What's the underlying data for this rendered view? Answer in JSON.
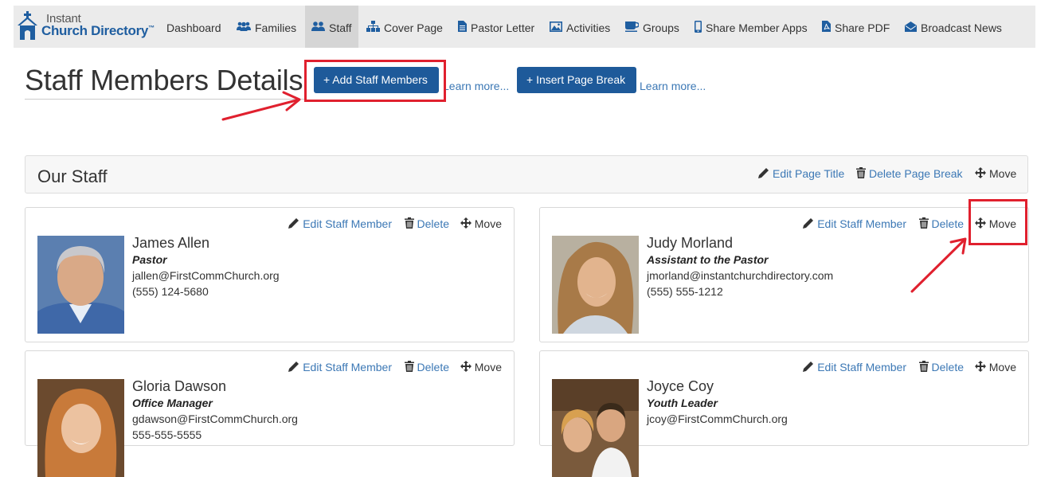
{
  "brand": {
    "line1": "Instant",
    "line2": "Church Directory",
    "tm": "™"
  },
  "nav": {
    "items": [
      {
        "id": "dashboard",
        "label": "Dashboard",
        "icon": "none"
      },
      {
        "id": "families",
        "label": "Families",
        "icon": "users-icon"
      },
      {
        "id": "staff",
        "label": "Staff",
        "icon": "user-pair-icon",
        "active": true
      },
      {
        "id": "cover",
        "label": "Cover Page",
        "icon": "sitemap-icon"
      },
      {
        "id": "pastor",
        "label": "Pastor Letter",
        "icon": "document-icon"
      },
      {
        "id": "activities",
        "label": "Activities",
        "icon": "image-icon"
      },
      {
        "id": "groups",
        "label": "Groups",
        "icon": "coffee-cup-icon"
      },
      {
        "id": "apps",
        "label": "Share Member Apps",
        "icon": "mobile-icon"
      },
      {
        "id": "pdf",
        "label": "Share PDF",
        "icon": "pdf-icon"
      },
      {
        "id": "news",
        "label": "Broadcast News",
        "icon": "envelope-open-icon"
      }
    ]
  },
  "header": {
    "title": "Staff Members Details",
    "add_button": "+ Add Staff Members",
    "learn_more_1": "Learn more...",
    "insert_break_button": "+ Insert Page Break",
    "learn_more_2": "Learn more..."
  },
  "section": {
    "title": "Our Staff",
    "edit_title": "Edit Page Title",
    "delete_break": "Delete Page Break",
    "move": "Move"
  },
  "card_actions": {
    "edit": "Edit Staff Member",
    "delete": "Delete",
    "move": "Move"
  },
  "staff": [
    {
      "name": "James Allen",
      "role": "Pastor",
      "email": "jallen@FirstCommChurch.org",
      "phone": "(555) 124-5680"
    },
    {
      "name": "Judy Morland",
      "role": "Assistant to the Pastor",
      "email": "jmorland@instantchurchdirectory.com",
      "phone": "(555) 555-1212"
    },
    {
      "name": "Gloria Dawson",
      "role": "Office Manager",
      "email": "gdawson@FirstCommChurch.org",
      "phone": "555-555-5555"
    },
    {
      "name": "Joyce Coy",
      "role": "Youth Leader",
      "email": "jcoy@FirstCommChurch.org",
      "phone": ""
    }
  ],
  "colors": {
    "brand_blue": "#1e5a9a",
    "link": "#3c78b5",
    "annotation_red": "#e0202e",
    "nav_bg": "#ebebeb"
  }
}
